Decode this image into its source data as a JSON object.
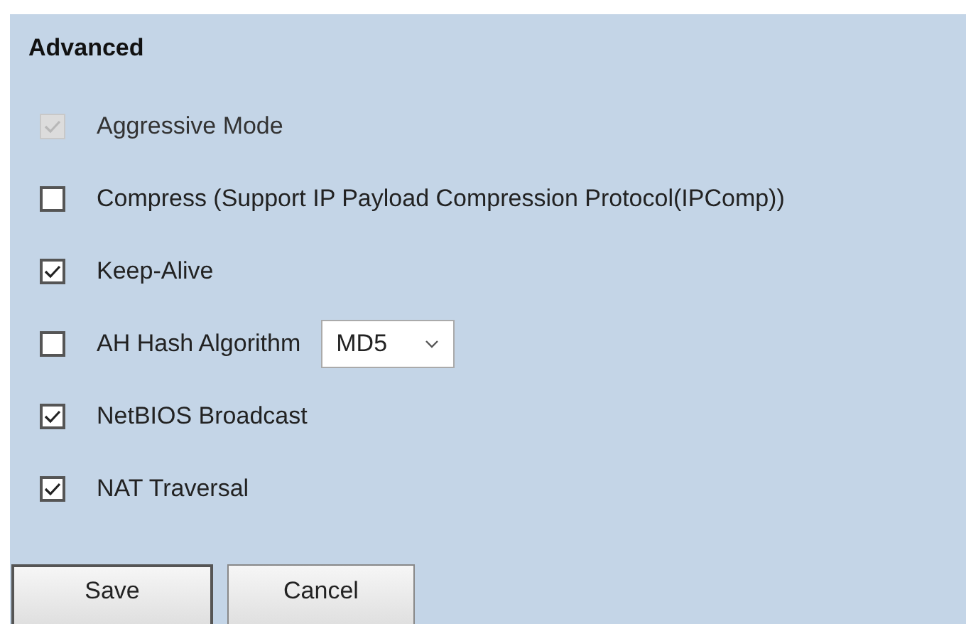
{
  "section": {
    "title": "Advanced"
  },
  "options": [
    {
      "label": "Aggressive Mode",
      "checked": true,
      "disabled": true
    },
    {
      "label": "Compress (Support IP Payload Compression Protocol(IPComp))",
      "checked": false,
      "disabled": false
    },
    {
      "label": "Keep-Alive",
      "checked": true,
      "disabled": false
    },
    {
      "label": "AH Hash Algorithm",
      "checked": false,
      "disabled": false,
      "select": {
        "value": "MD5"
      }
    },
    {
      "label": "NetBIOS Broadcast",
      "checked": true,
      "disabled": false
    },
    {
      "label": "NAT Traversal",
      "checked": true,
      "disabled": false
    }
  ],
  "buttons": [
    {
      "label": "Save"
    },
    {
      "label": "Cancel"
    }
  ]
}
